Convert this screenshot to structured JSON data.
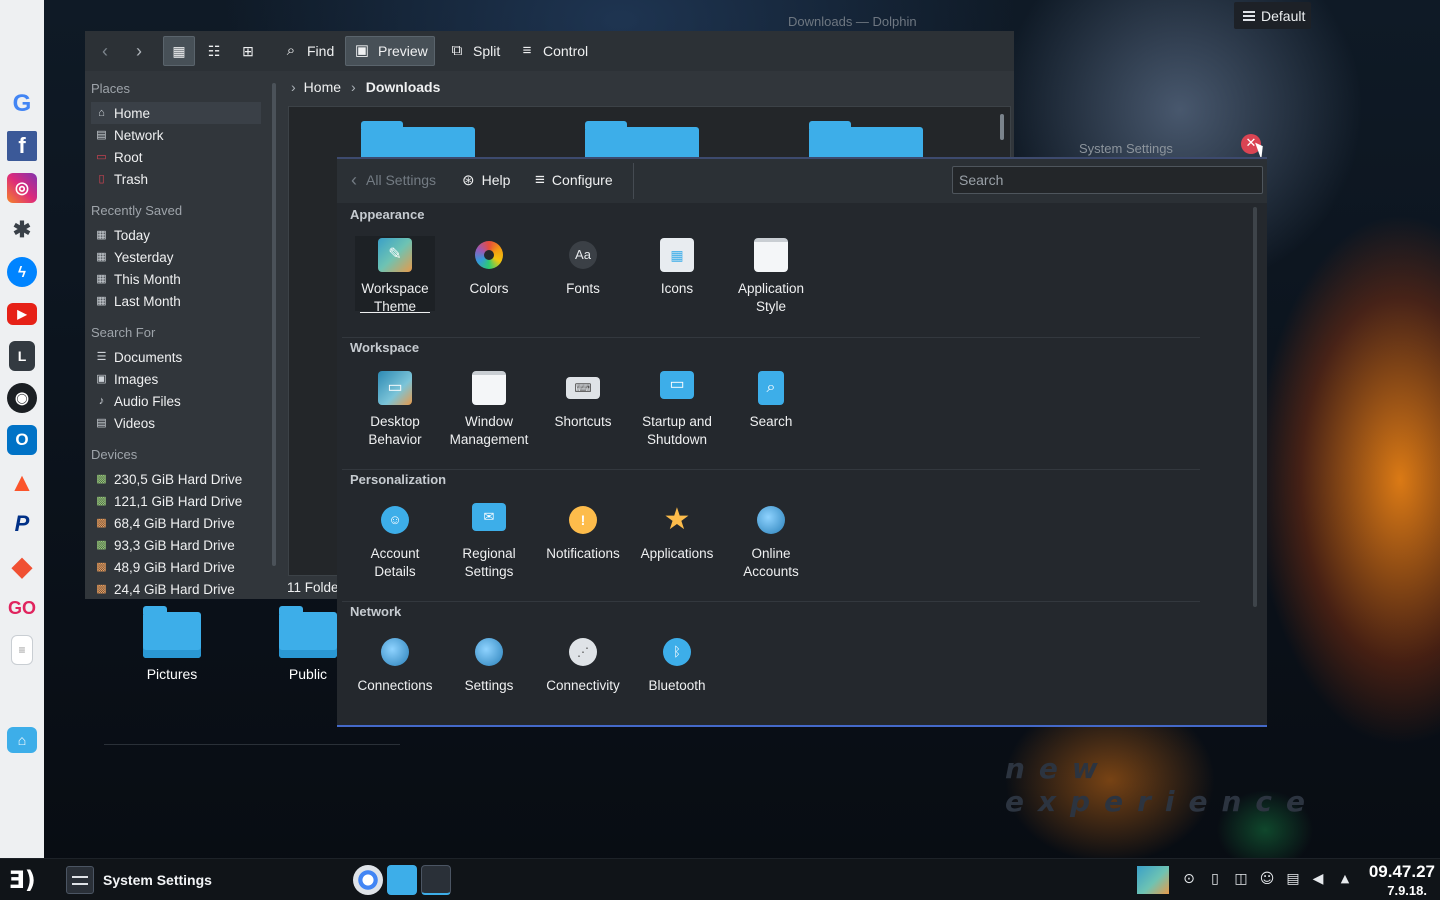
{
  "desktop": {
    "layout_button": "Default",
    "bg_window_title": "Downloads — Dolphin",
    "bg_settings_title": "System Settings",
    "watermark": "new experience",
    "folders": [
      {
        "label": "Pictures"
      },
      {
        "label": "Public"
      }
    ]
  },
  "dolphin": {
    "toolbar": {
      "find": "Find",
      "preview": "Preview",
      "split": "Split",
      "control": "Control"
    },
    "places": {
      "places_heading": "Places",
      "places_items": [
        "Home",
        "Network",
        "Root",
        "Trash"
      ],
      "recent_heading": "Recently Saved",
      "recent_items": [
        "Today",
        "Yesterday",
        "This Month",
        "Last Month"
      ],
      "search_heading": "Search For",
      "search_items": [
        "Documents",
        "Images",
        "Audio Files",
        "Videos"
      ],
      "devices_heading": "Devices",
      "devices": [
        "230,5 GiB Hard Drive",
        "121,1 GiB Hard Drive",
        "68,4 GiB Hard Drive",
        "93,3 GiB Hard Drive",
        "48,9 GiB Hard Drive",
        "24,4 GiB Hard Drive"
      ]
    },
    "breadcrumb": {
      "home": "Home",
      "current": "Downloads"
    },
    "status": "11 Folde"
  },
  "settings": {
    "toolbar": {
      "all_settings": "All Settings",
      "help": "Help",
      "configure": "Configure",
      "search_placeholder": "Search"
    },
    "sections": {
      "appearance": {
        "heading": "Appearance",
        "items": [
          "Workspace Theme",
          "Colors",
          "Fonts",
          "Icons",
          "Application Style"
        ]
      },
      "workspace": {
        "heading": "Workspace",
        "items": [
          "Desktop Behavior",
          "Window Management",
          "Shortcuts",
          "Startup and Shutdown",
          "Search"
        ]
      },
      "personalization": {
        "heading": "Personalization",
        "items": [
          "Account Details",
          "Regional Settings",
          "Notifications",
          "Applications",
          "Online Accounts"
        ]
      },
      "network": {
        "heading": "Network",
        "items": [
          "Connections",
          "Settings",
          "Connectivity",
          "Bluetooth"
        ]
      }
    },
    "icon_names": {
      "appearance": [
        "workspace-theme-icon",
        "colors-icon",
        "fonts-icon",
        "icons-icon",
        "application-style-icon"
      ],
      "workspace": [
        "desktop-behavior-icon",
        "window-management-icon",
        "shortcuts-icon",
        "startup-shutdown-icon",
        "search-icon"
      ],
      "personalization": [
        "account-details-icon",
        "regional-settings-icon",
        "notifications-icon",
        "applications-icon",
        "online-accounts-icon"
      ],
      "network": [
        "connections-icon",
        "network-settings-icon",
        "connectivity-icon",
        "bluetooth-icon"
      ]
    }
  },
  "taskbar": {
    "active_task": "System Settings",
    "clock_time": "09.47.27",
    "clock_date": "7.9.18."
  },
  "dock": {
    "apps": [
      "google-icon",
      "facebook-icon",
      "instagram-icon",
      "kde-icon",
      "messenger-icon",
      "youtube-icon",
      "l-app-icon",
      "github-icon",
      "outlook-icon",
      "brave-icon",
      "paypal-icon",
      "git-icon",
      "go-icon",
      "text-editor-icon",
      "home-folder-icon"
    ]
  },
  "colors": {
    "accent": "#3daee9",
    "window_bg": "#31363b",
    "settings_bg": "#24282d",
    "close": "#da4453",
    "dock_bg": "#eef0f2"
  }
}
